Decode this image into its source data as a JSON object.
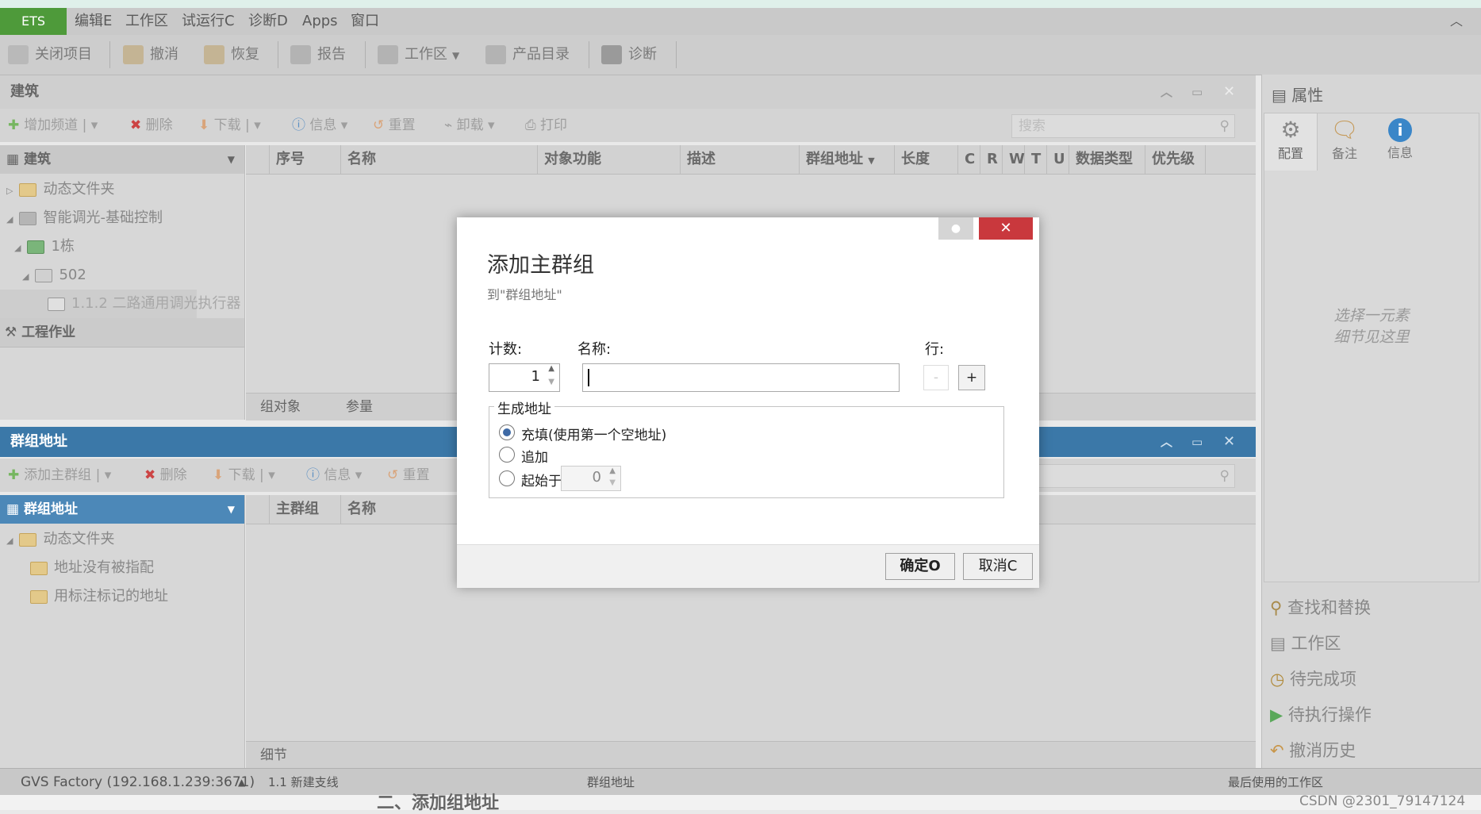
{
  "app": {
    "ets_button": "ETS"
  },
  "menu": [
    "编辑E",
    "工作区",
    "试运行C",
    "诊断D",
    "Apps",
    "窗口"
  ],
  "toolbar": {
    "close_project": "关闭项目",
    "undo": "撤消",
    "redo": "恢复",
    "report": "报告",
    "workspace": "工作区",
    "catalog": "产品目录",
    "diagnose": "诊断"
  },
  "building_panel": {
    "title": "建筑",
    "toolbar": {
      "add_channel": "增加频道",
      "delete": "删除",
      "download": "下载",
      "info": "信息",
      "reset": "重置",
      "unload": "卸载",
      "print": "打印",
      "search_placeholder": "搜索"
    },
    "tree_header": "建筑",
    "tree": [
      "动态文件夹",
      "智能调光-基础控制",
      "1栋",
      "502",
      "1.1.2 二路通用调光执行器"
    ],
    "engineering": "工程作业",
    "columns": [
      "序号",
      "名称",
      "对象功能",
      "描述",
      "群组地址",
      "长度",
      "C",
      "R",
      "W",
      "T",
      "U",
      "数据类型",
      "优先级"
    ],
    "tabs": [
      "组对象",
      "参量"
    ]
  },
  "group_panel": {
    "title": "群组地址",
    "toolbar": {
      "add_main": "添加主群组",
      "delete": "删除",
      "download": "下载",
      "info": "信息",
      "reset": "重置"
    },
    "tree_header": "群组地址",
    "tree": [
      "动态文件夹",
      "地址没有被指配",
      "用标注标记的地址"
    ],
    "columns": [
      "主群组",
      "名称"
    ],
    "tabs": [
      "细节"
    ]
  },
  "properties": {
    "title": "属性",
    "tabs": [
      "配置",
      "备注",
      "信息"
    ],
    "empty_hint_line1": "选择一元素",
    "empty_hint_line2": "细节见这里",
    "links": [
      "查找和替换",
      "工作区",
      "待完成项",
      "待执行操作",
      "撤消历史"
    ]
  },
  "status": {
    "connection": "GVS Factory (192.168.1.239:3671)",
    "line": "1.1 新建支线",
    "context": "群组地址",
    "last_workspace": "最后使用的工作区",
    "watermark": "CSDN @2301_79147124",
    "behind_text": "二、添加组地址"
  },
  "dialog": {
    "title": "添加主群组",
    "subtitle": "到\"群组地址\"",
    "count_label": "计数:",
    "count_value": "1",
    "name_label": "名称:",
    "name_value": "",
    "row_label": "行:",
    "minus": "-",
    "plus": "+",
    "group_label": "生成地址",
    "options": [
      "充填(使用第一个空地址)",
      "追加",
      "起始于"
    ],
    "selected_option": 0,
    "start_value": "0",
    "ok": "确定O",
    "cancel": "取消C"
  },
  "colors": {
    "ets_green": "#4e9a3a",
    "group_header_blue": "#3b78a8",
    "close_red": "#c9383d",
    "radio_blue": "#3f6aa5"
  }
}
